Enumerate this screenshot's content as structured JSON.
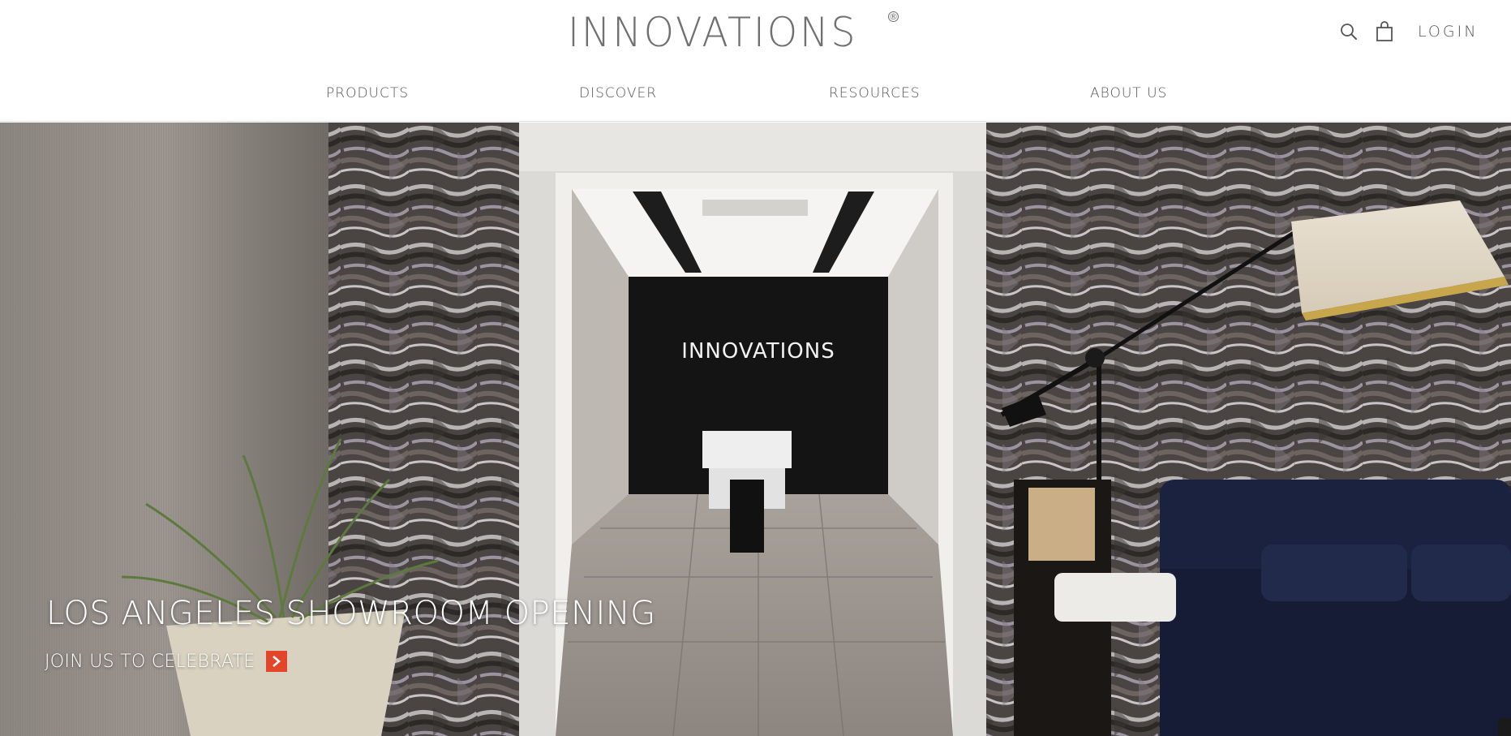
{
  "brand": {
    "logo_text": "INNOVATIONS",
    "registered_mark": "®"
  },
  "header": {
    "login_label": "LOGIN",
    "search_icon": "search-icon",
    "cart_icon": "shopping-bag-icon"
  },
  "nav": {
    "items": [
      {
        "label": "PRODUCTS"
      },
      {
        "label": "DISCOVER"
      },
      {
        "label": "RESOURCES"
      },
      {
        "label": "ABOUT US"
      }
    ]
  },
  "hero": {
    "title": "LOS ANGELES SHOWROOM OPENING",
    "cta_label": "JOIN US TO CELEBRATE",
    "cta_icon": "chevron-right-icon",
    "wall_sign_text": "INNOVATIONS"
  },
  "colors": {
    "accent": "#e2452a",
    "nav_text": "#555555",
    "logo_gray": "#707070",
    "sofa_navy": "#1b2240"
  }
}
